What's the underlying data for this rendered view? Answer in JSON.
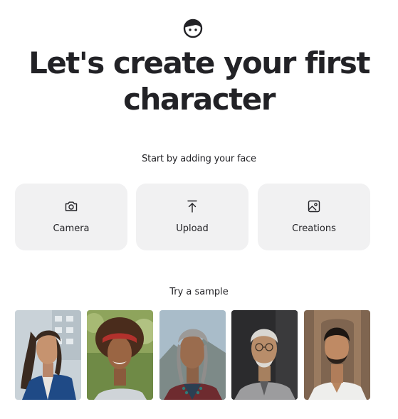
{
  "logo": {
    "icon": "face-icon"
  },
  "headline": {
    "line1": "Let's create your first",
    "line2": "character"
  },
  "subtitle": "Start by adding your face",
  "options": [
    {
      "label": "Camera",
      "icon": "camera-icon"
    },
    {
      "label": "Upload",
      "icon": "upload-icon"
    },
    {
      "label": "Creations",
      "icon": "image-icon"
    }
  ],
  "samples_title": "Try a sample",
  "colors": {
    "text": "#222226",
    "card_background": "#f1f1f2",
    "page_background": "#ffffff"
  }
}
